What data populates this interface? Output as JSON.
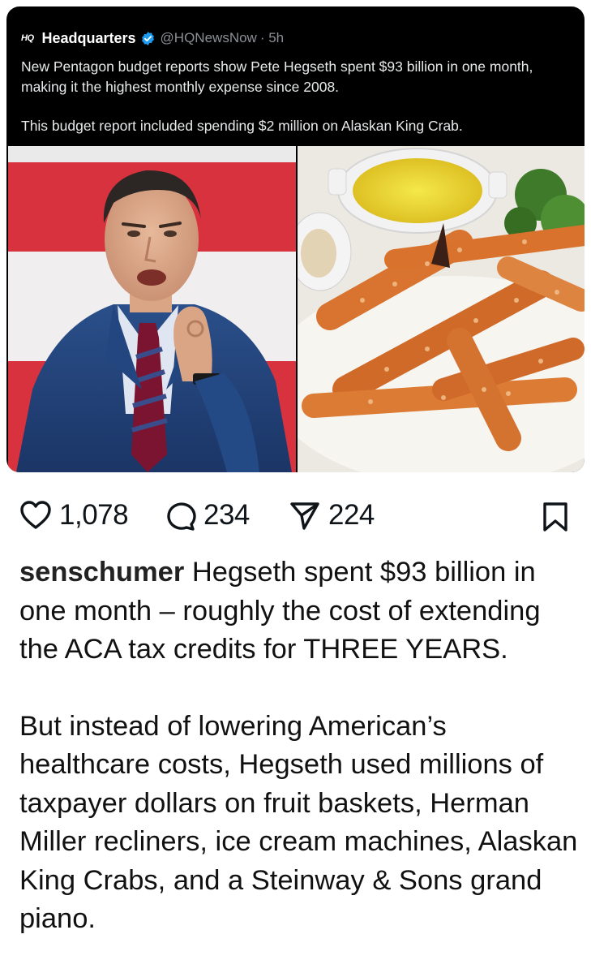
{
  "tweet": {
    "logo_text": "HQ",
    "author": "Headquarters",
    "handle": "@HQNewsNow",
    "time": "· 5h",
    "text_1": "New Pentagon budget reports show Pete Hegseth spent $93 billion in one month, making it the highest monthly expense since 2008.",
    "text_2": "This budget report included spending $2 million on Alaskan King Crab."
  },
  "images": {
    "left": "photo of man in blue suit speaking",
    "right": "platter of king crab legs with butter"
  },
  "actions": {
    "likes": "1,078",
    "comments": "234",
    "shares": "224",
    "icons": [
      "heart-icon",
      "comment-icon",
      "share-icon",
      "bookmark-icon"
    ]
  },
  "post": {
    "username": "senschumer",
    "caption_1": "Hegseth spent $93 billion in one month – roughly the cost of extending the ACA tax credits for THREE YEARS.",
    "caption_2": "But instead of lowering American’s healthcare costs, Hegseth used millions of taxpayer dollars on fruit baskets, Herman Miller recliners, ice cream machines, Alaskan King Crabs, and a Steinway & Sons grand piano."
  },
  "colors": {
    "verified": "#1d9bf0",
    "card_bg": "#000000",
    "handle": "#8b8f94"
  }
}
